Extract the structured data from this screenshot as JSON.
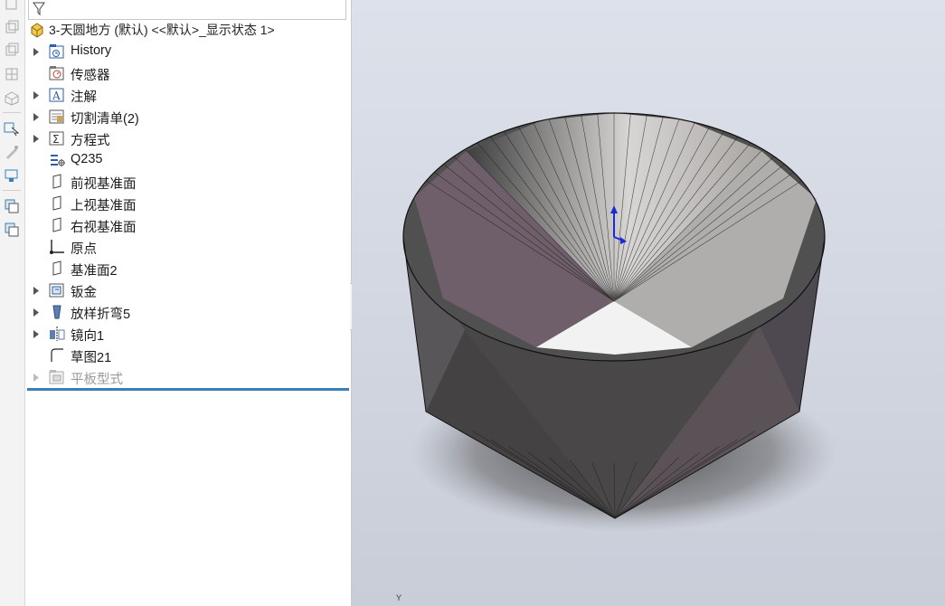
{
  "feature_tree": {
    "root": "3-天圆地方 (默认) <<默认>_显示状态 1>",
    "items": [
      {
        "label": "History",
        "icon": "history-icon",
        "expandable": true
      },
      {
        "label": "传感器",
        "icon": "sensor-icon",
        "expandable": false
      },
      {
        "label": "注解",
        "icon": "annotation-icon",
        "expandable": true
      },
      {
        "label": "切割清单(2)",
        "icon": "cut-list-icon",
        "expandable": true
      },
      {
        "label": "方程式",
        "icon": "equation-icon",
        "expandable": true
      },
      {
        "label": "Q235",
        "icon": "material-icon",
        "expandable": false
      },
      {
        "label": "前视基准面",
        "icon": "plane-icon",
        "expandable": false
      },
      {
        "label": "上视基准面",
        "icon": "plane-icon",
        "expandable": false
      },
      {
        "label": "右视基准面",
        "icon": "plane-icon",
        "expandable": false
      },
      {
        "label": "原点",
        "icon": "origin-icon",
        "expandable": false
      },
      {
        "label": "基准面2",
        "icon": "plane-icon",
        "expandable": false
      },
      {
        "label": "钣金",
        "icon": "sheet-metal-icon",
        "expandable": true
      },
      {
        "label": "放样折弯5",
        "icon": "lofted-bend-icon",
        "expandable": true
      },
      {
        "label": "镜向1",
        "icon": "mirror-icon",
        "expandable": true
      },
      {
        "label": "草图21",
        "icon": "sketch-icon",
        "expandable": false
      },
      {
        "label": "平板型式",
        "icon": "flat-pattern-icon",
        "expandable": true,
        "suppressed": true
      }
    ]
  },
  "viewport": {
    "axis_label": "Y",
    "accent_color": "#3a7fb5"
  }
}
